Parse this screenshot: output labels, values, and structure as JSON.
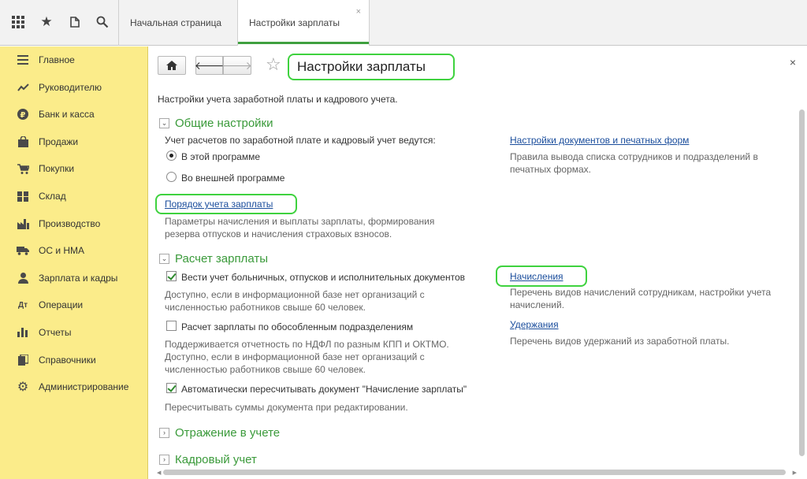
{
  "tabs": [
    {
      "label": "Начальная страница"
    },
    {
      "label": "Настройки зарплаты",
      "close": "×"
    }
  ],
  "sidebar": {
    "items": [
      {
        "label": "Главное",
        "icon": "menu-icon"
      },
      {
        "label": "Руководителю",
        "icon": "trend-icon"
      },
      {
        "label": "Банк и касса",
        "icon": "ruble-icon"
      },
      {
        "label": "Продажи",
        "icon": "bag-icon"
      },
      {
        "label": "Покупки",
        "icon": "cart-icon"
      },
      {
        "label": "Склад",
        "icon": "warehouse-icon"
      },
      {
        "label": "Производство",
        "icon": "factory-icon"
      },
      {
        "label": "ОС и НМА",
        "icon": "truck-icon"
      },
      {
        "label": "Зарплата и кадры",
        "icon": "person-icon"
      },
      {
        "label": "Операции",
        "icon": "operations-icon"
      },
      {
        "label": "Отчеты",
        "icon": "bar-chart-icon"
      },
      {
        "label": "Справочники",
        "icon": "books-icon"
      },
      {
        "label": "Администрирование",
        "icon": "gear-icon"
      }
    ]
  },
  "main": {
    "title": "Настройки зарплаты",
    "close": "×",
    "description": "Настройки учета заработной платы и кадрового учета.",
    "sections": {
      "general": {
        "title": "Общие настройки",
        "accounting_label": "Учет расчетов по заработной плате и кадровый учет ведутся:",
        "radio_this": "В этой программе",
        "radio_external": "Во внешней программе",
        "link_order": "Порядок учета зарплаты",
        "order_desc": "Параметры начисления и выплаты зарплаты, формирования резерва отпусков и начисления страховых взносов.",
        "link_docs": "Настройки документов и печатных форм",
        "docs_desc": "Правила вывода списка сотрудников и подразделений в печатных формах."
      },
      "payroll": {
        "title": "Расчет зарплаты",
        "cb1_label": "Вести учет больничных, отпусков и исполнительных документов",
        "cb1_desc": "Доступно, если в информационной базе нет организаций с численностью работников свыше 60 человек.",
        "cb2_label": "Расчет зарплаты по обособленным подразделениям",
        "cb2_desc": "Поддерживается отчетность по НДФЛ по разным КПП и ОКТМО. Доступно, если в информационной базе нет организаций с численностью работников свыше 60 человек.",
        "cb3_label": "Автоматически пересчитывать документ \"Начисление зарплаты\"",
        "cb3_desc": "Пересчитывать суммы документа при редактировании.",
        "link_accruals": "Начисления",
        "accruals_desc": "Перечень видов начислений сотрудникам, настройки учета начислений.",
        "link_deductions": "Удержания",
        "deductions_desc": "Перечень видов удержаний из заработной платы."
      },
      "reflection": {
        "title": "Отражение в учете"
      },
      "hr": {
        "title": "Кадровый учет"
      }
    }
  }
}
